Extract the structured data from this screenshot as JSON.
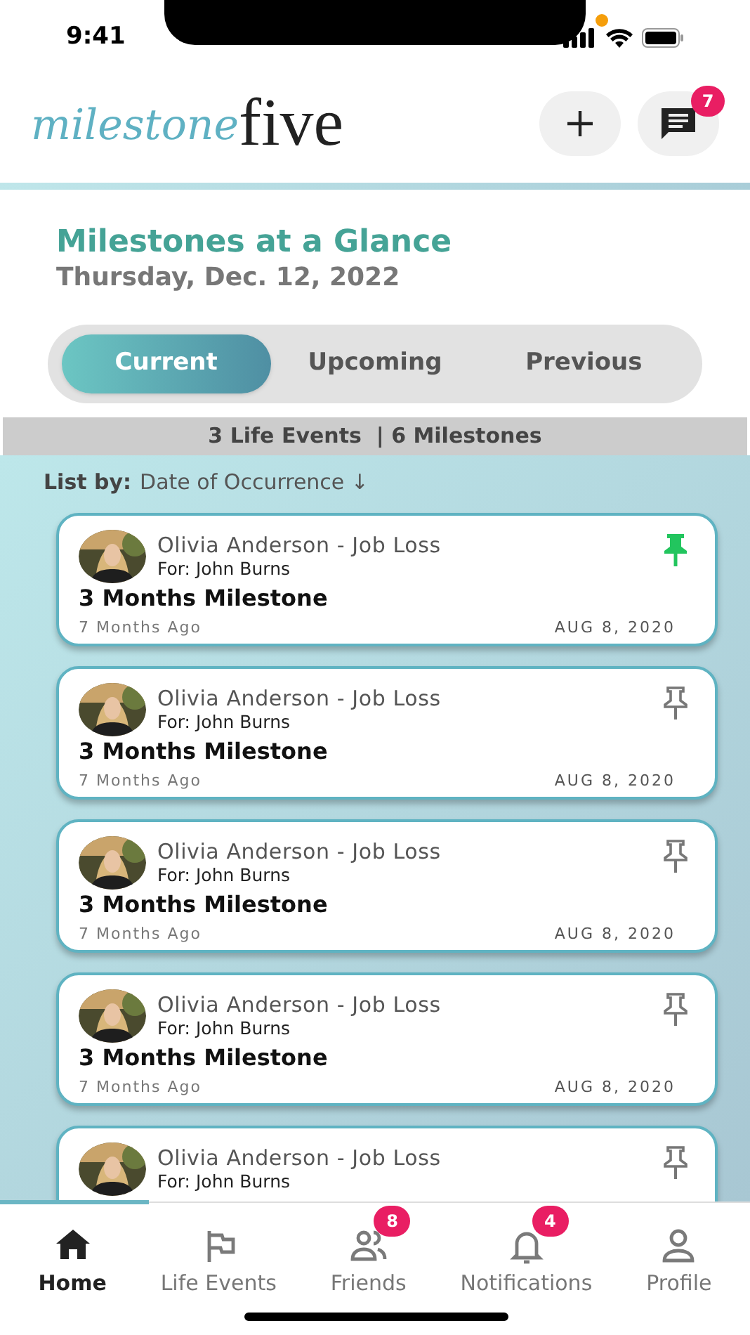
{
  "status_bar": {
    "time": "9:41"
  },
  "header": {
    "logo_script": "milestone",
    "logo_word": "five",
    "messages_badge": "7"
  },
  "summary": {
    "title": "Milestones at a Glance",
    "date": "Thursday, Dec. 12, 2022"
  },
  "tabs": [
    {
      "label": "Current",
      "selected": true
    },
    {
      "label": "Upcoming",
      "selected": false
    },
    {
      "label": "Previous",
      "selected": false
    }
  ],
  "counts": "3 Life Events  | 6 Milestones",
  "sort": {
    "label": "List by:",
    "value": "Date of Occurrence ↓"
  },
  "cards": [
    {
      "title": "Olivia Anderson - Job Loss",
      "for": "For: John Burns",
      "milestone": "3 Months Milestone",
      "ago": "7 Months Ago",
      "date": "AUG 8, 2020",
      "pinned": true
    },
    {
      "title": "Olivia Anderson - Job Loss",
      "for": "For: John Burns",
      "milestone": "3 Months Milestone",
      "ago": "7 Months Ago",
      "date": "AUG 8, 2020",
      "pinned": false
    },
    {
      "title": "Olivia Anderson - Job Loss",
      "for": "For: John Burns",
      "milestone": "3 Months Milestone",
      "ago": "7 Months Ago",
      "date": "AUG 8, 2020",
      "pinned": false
    },
    {
      "title": "Olivia Anderson - Job Loss",
      "for": "For: John Burns",
      "milestone": "3 Months Milestone",
      "ago": "7 Months Ago",
      "date": "AUG 8, 2020",
      "pinned": false
    },
    {
      "title": "Olivia Anderson - Job Loss",
      "for": "For: John Burns",
      "pinned": false
    }
  ],
  "nav": [
    {
      "kind": "home",
      "label": "Home",
      "selected": true
    },
    {
      "kind": "flag",
      "label": "Life Events",
      "selected": false
    },
    {
      "kind": "friends",
      "label": "Friends",
      "selected": false,
      "badge": "8"
    },
    {
      "kind": "bell",
      "label": "Notifications",
      "selected": false,
      "badge": "4"
    },
    {
      "kind": "person",
      "label": "Profile",
      "selected": false
    }
  ]
}
